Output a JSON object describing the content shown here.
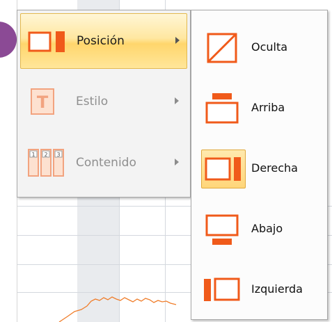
{
  "colors": {
    "accent_orange": "#f05a1a",
    "hover_gold": "#ffd66c",
    "badge_purple": "#8b4a95",
    "disabled_gray": "#8f8f8f"
  },
  "menu": {
    "items": [
      {
        "label": "Posición",
        "icon": "legend-position-icon",
        "state": "active"
      },
      {
        "label": "Estilo",
        "icon": "text-style-icon",
        "state": "disabled"
      },
      {
        "label": "Contenido",
        "icon": "legend-content-icon",
        "state": "disabled"
      }
    ]
  },
  "submenu": {
    "items": [
      {
        "label": "Oculta",
        "icon": "legend-hidden-icon",
        "selected": false
      },
      {
        "label": "Arriba",
        "icon": "legend-top-icon",
        "selected": false
      },
      {
        "label": "Derecha",
        "icon": "legend-right-icon",
        "selected": true
      },
      {
        "label": "Abajo",
        "icon": "legend-bottom-icon",
        "selected": false
      },
      {
        "label": "Izquierda",
        "icon": "legend-left-icon",
        "selected": false
      }
    ]
  },
  "icon_glyphs": {
    "style_letter": "T",
    "content_digits": [
      "1",
      "2",
      "3"
    ]
  }
}
